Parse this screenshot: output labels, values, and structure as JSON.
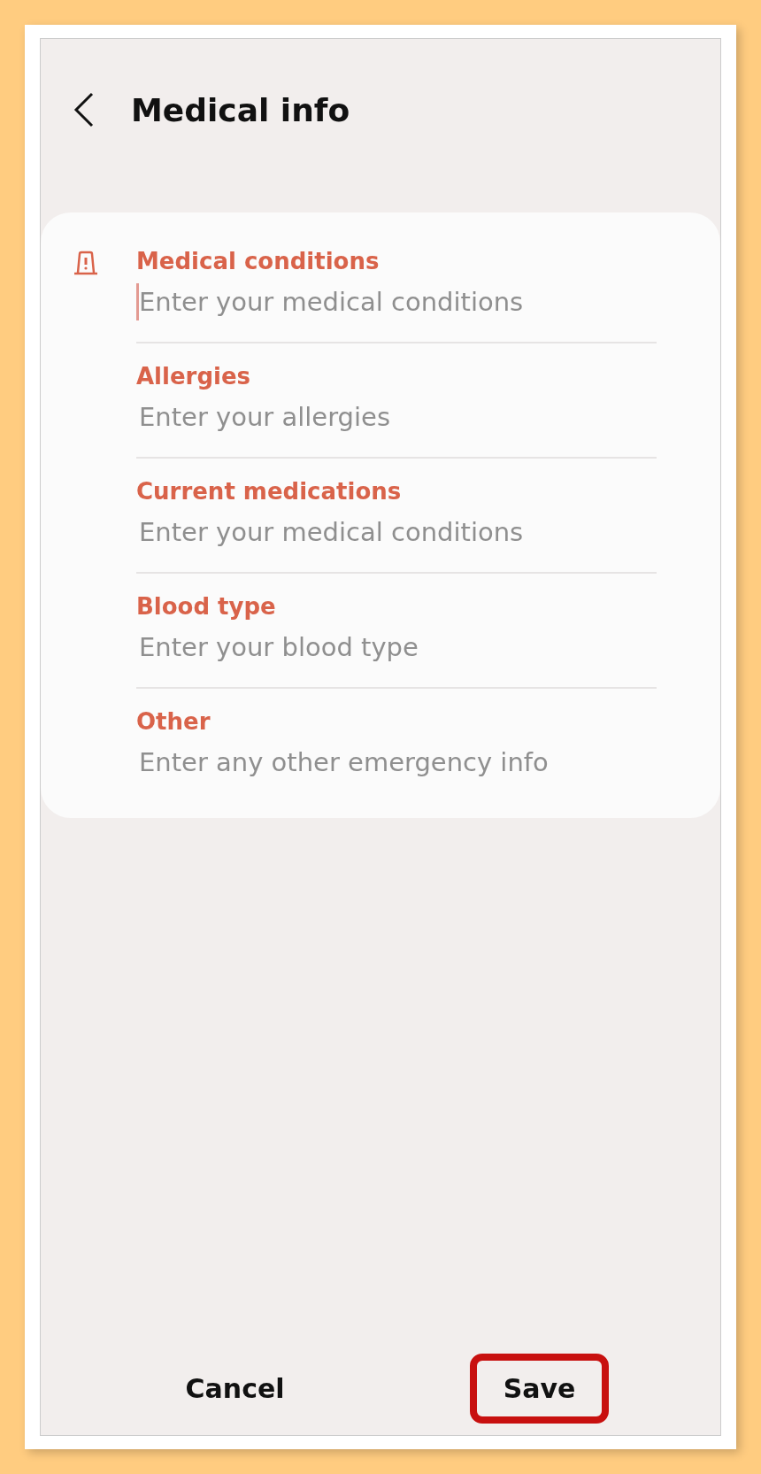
{
  "header": {
    "title": "Medical info"
  },
  "fields": [
    {
      "label": "Medical conditions",
      "placeholder": "Enter your medical conditions",
      "focused": true
    },
    {
      "label": "Allergies",
      "placeholder": "Enter your allergies",
      "focused": false
    },
    {
      "label": "Current medications",
      "placeholder": "Enter your medical conditions",
      "focused": false
    },
    {
      "label": "Blood type",
      "placeholder": "Enter your blood type",
      "focused": false
    },
    {
      "label": "Other",
      "placeholder": "Enter any other emergency info",
      "focused": false
    }
  ],
  "buttons": [
    {
      "label": "Cancel",
      "highlighted": false
    },
    {
      "label": "Save",
      "highlighted": true
    }
  ]
}
